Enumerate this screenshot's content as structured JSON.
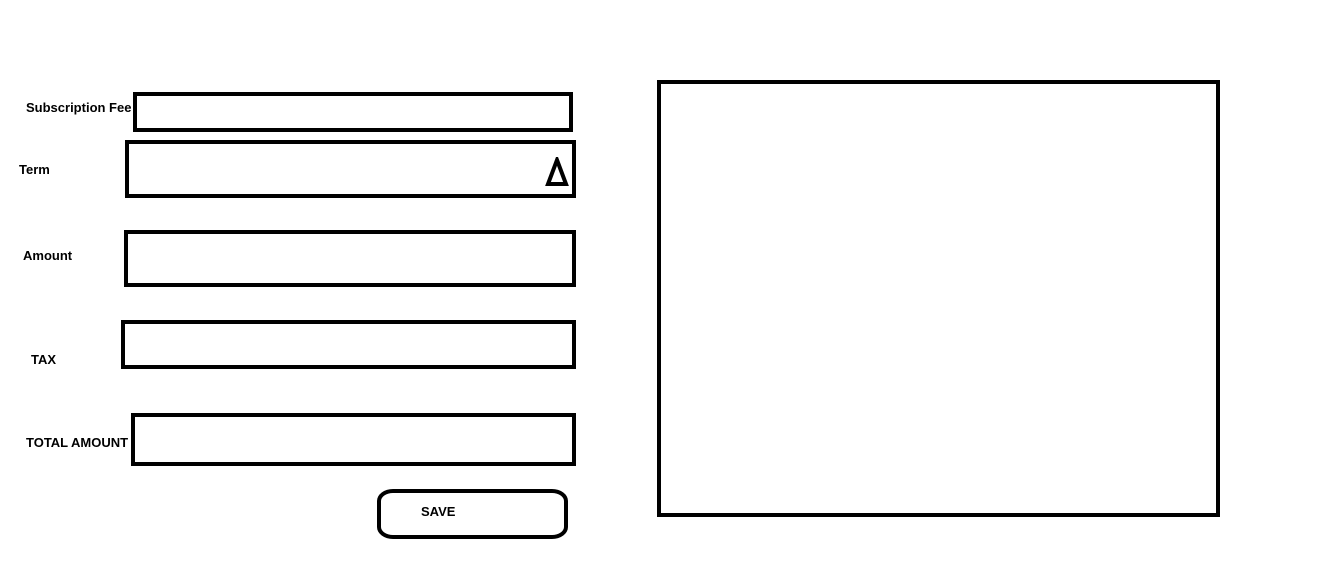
{
  "form": {
    "subscription_fee": {
      "label": "Subscription Fee",
      "value": "",
      "placeholder": ""
    },
    "term": {
      "label": "Term",
      "value": "",
      "placeholder": "",
      "icon": "triangle-up-icon"
    },
    "amount": {
      "label": "Amount",
      "value": "",
      "placeholder": ""
    },
    "tax": {
      "label": "TAX",
      "value": "",
      "placeholder": ""
    },
    "total_amount": {
      "label": "TOTAL AMOUNT",
      "value": "",
      "placeholder": ""
    },
    "save_label": "SAVE"
  },
  "colors": {
    "border": "#000000",
    "background": "#ffffff",
    "text": "#000000"
  }
}
